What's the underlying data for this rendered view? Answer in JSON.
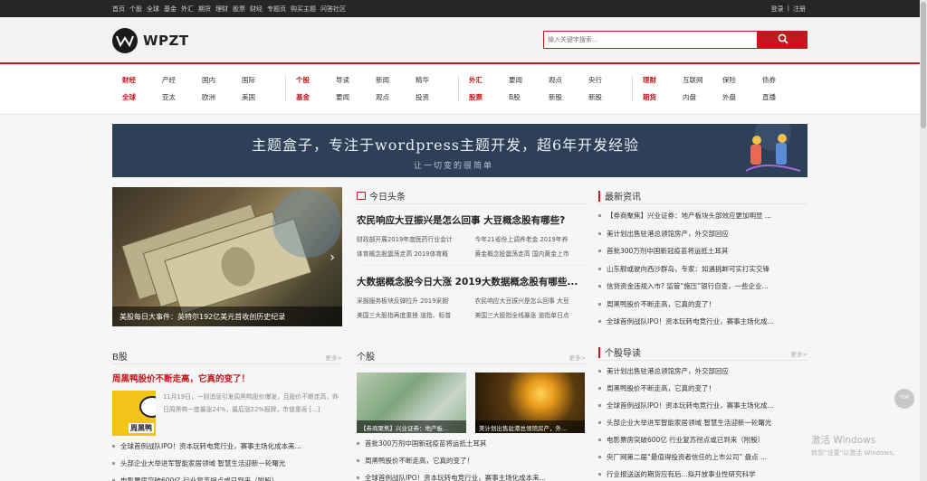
{
  "topbar": {
    "links": [
      "首页",
      "个股",
      "全球",
      "基金",
      "外汇",
      "期货",
      "理财",
      "股票",
      "财经",
      "专题页",
      "购买主题",
      "问答社区"
    ],
    "login": "登录",
    "sep": "|",
    "register": "注册"
  },
  "header": {
    "logo_text": "WPZT",
    "search_placeholder": "输入关键字搜索..."
  },
  "nav": {
    "groups": [
      {
        "rows": [
          [
            "财经",
            "产经",
            "国内",
            "国际"
          ],
          [
            "全球",
            "亚太",
            "欧洲",
            "美国"
          ]
        ]
      },
      {
        "rows": [
          [
            "个股",
            "导读",
            "新闻",
            "精华"
          ],
          [
            "基金",
            "要闻",
            "观点",
            "投资"
          ]
        ]
      },
      {
        "rows": [
          [
            "外汇",
            "要闻",
            "观点",
            "央行"
          ],
          [
            "股票",
            "B股",
            "新股",
            "新股"
          ]
        ]
      },
      {
        "rows": [
          [
            "理财",
            "互联网",
            "保险",
            "债券"
          ],
          [
            "期货",
            "内盘",
            "外盘",
            "直播"
          ]
        ]
      }
    ]
  },
  "banner": {
    "title": "主题盒子，专注于wordpress主题开发，超6年开发经验",
    "subtitle": "让一切变的很简单"
  },
  "hero": {
    "caption": "美股每日大事件：英特尔192亿美元首收创历史纪录"
  },
  "toutiao": {
    "title": "今日头条",
    "blocks": [
      {
        "headline": "农民响应大豆振兴是怎么回事 大豆概念股有哪些?",
        "subs": [
          "财政部开展2019年度医药行业会计",
          "今年21省份上调养老金 2019年养",
          "体育概念股震荡走高 2019体育概",
          "黄金概念股震荡走高 国内黄金上市"
        ]
      },
      {
        "headline": "大数据概念股今日大涨 2019大数据概念股有哪些...",
        "subs": [
          "采掘服务板块反弹拉升 2019采掘",
          "农民响应大豆振兴是怎么回事 大豆",
          "美国三大股指再度重挫 道指、标普",
          "美国三大股指全线暴涨 道指单日点"
        ]
      }
    ]
  },
  "latest": {
    "title": "最新资讯",
    "items": [
      "【券商聚焦】兴业证券：地产板块头部效应更加明显 ...",
      "美计划出售驻港总领馆房产，外交部回应",
      "首批300万剂中国新冠疫苗将运抵土耳其",
      "山东舰或驶向西沙群岛，专家：如遇挑衅可实打实交锋",
      "信贷资金违规入市? 监管“施压”银行自查，一些企业...",
      "周黑鸭股价不断走高，它真的变了！",
      "全球首例战队IPO！资本玩转电竞行业，赛事主场化成..."
    ]
  },
  "bstock": {
    "title": "B股",
    "more": "更多>",
    "headline": "周黑鸭股价不断走高，它真的变了！",
    "thumb_text": "周黑鸭",
    "desc": "11月19日，一则消息引发周黑鸭股价爆发，且股价不断走高，昨日周黑鸭一度暴涨24%，最后涨22%报牌，市值重返 [...]",
    "list": [
      "全球首例战队IPO！资本玩转电竞行业，赛事主场化成本来...",
      "头部企业大举进军智能家居领域 智慧生活迎新一轮曙光",
      "电影票房突破600亿 行业复苏拐点或已到来（附股）"
    ]
  },
  "gegu": {
    "title": "个股",
    "more": "更多>",
    "pics": [
      {
        "caption": "【券商聚焦】兴业证券：地产板..."
      },
      {
        "caption": "美计划出售驻港总领馆房产，外..."
      }
    ],
    "list": [
      "首批300万剂中国新冠疫苗将运抵土耳其",
      "周黑鸭股价不断走高，它真的变了！",
      "全球首例战队IPO！资本玩转电竞行业，赛事主场化成本来..."
    ]
  },
  "daodu": {
    "title": "个股导读",
    "more": "更多>",
    "items": [
      "美计划出售驻港总领馆房产，外交部回应",
      "周黑鸭股价不断走高，它真的变了！",
      "全球首例战队IPO！资本玩转电竞行业，赛事主场化成...",
      "头部企业大举进军智能家居领域 智慧生活迎新一轮曙光",
      "电影票房突破600亿 行业复苏拐点或已到来（附股）",
      "央厂网第二届“最值得投资者信任的上市公司” 盘点 ...",
      "行业报送送的期货应有后...拟开放事业性研究科学"
    ]
  },
  "totop": "TOP",
  "watermark": {
    "title": "激活 Windows",
    "sub": "转到“设置”以激活 Windows。"
  },
  "colors": {
    "accent": "#c4161c",
    "banner": "#2e3f58",
    "topbar": "#262626"
  }
}
